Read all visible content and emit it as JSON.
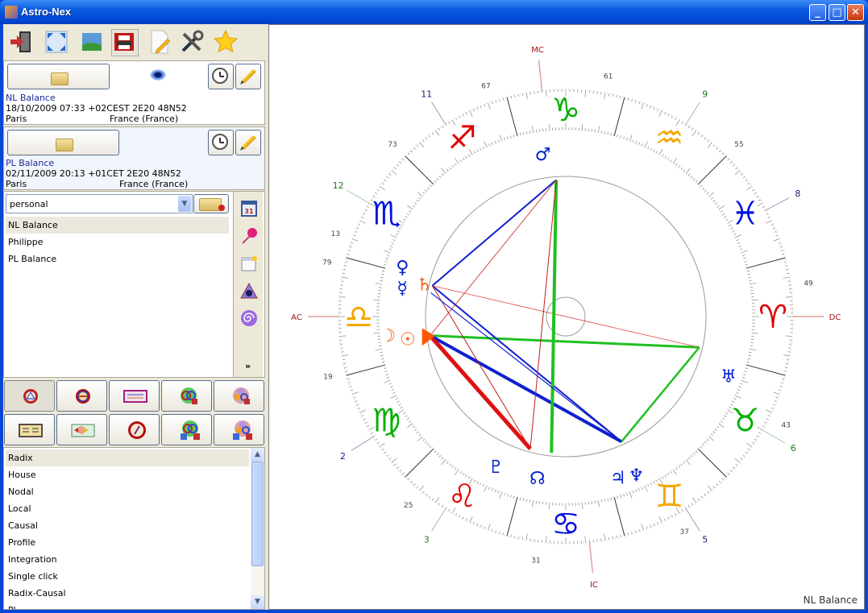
{
  "window": {
    "title": "Astro-Nex",
    "controls": {
      "minimize": "_",
      "maximize": "□",
      "close": "✕"
    }
  },
  "toolbar": {
    "items": [
      {
        "name": "exit",
        "icon": "exit-door-icon"
      },
      {
        "name": "fullscreen",
        "icon": "fullscreen-icon"
      },
      {
        "name": "image",
        "icon": "landscape-image-icon"
      },
      {
        "name": "print",
        "icon": "printer-icon"
      },
      {
        "name": "edit-document",
        "icon": "document-edit-icon"
      },
      {
        "name": "settings",
        "icon": "tools-icon"
      },
      {
        "name": "favorites",
        "icon": "star-icon"
      }
    ]
  },
  "chart1": {
    "name": "NL Balance",
    "datetime": "18/10/2009 07:33 +02CEST 2E20 48N52",
    "city": "Paris",
    "country": "France (France)",
    "visible_icon": "eye-icon"
  },
  "chart2": {
    "name": "PL Balance",
    "datetime": "02/11/2009 20:13 +01CET 2E20 48N52",
    "city": "Paris",
    "country": "France (France)"
  },
  "file_browser": {
    "category": "personal",
    "items": [
      "NL Balance",
      "Philippe",
      "PL Balance"
    ],
    "selected": "NL Balance",
    "more_label": "»"
  },
  "side_tools": [
    "calendar-icon",
    "pin-icon",
    "new-file-icon",
    "eye-triangle-icon",
    "spiral-icon"
  ],
  "chart_types": {
    "row1": [
      "radix",
      "house",
      "comparison",
      "synastry",
      "composite"
    ],
    "row2": [
      "table",
      "grid",
      "compass",
      "synastry-pair",
      "composite-pair"
    ],
    "pressed": "radix"
  },
  "chart_list": {
    "items": [
      "Radix",
      "House",
      "Nodal",
      "Local",
      "Causal",
      "Profile",
      "Integration",
      "Single click",
      "Radix-Causal",
      "Pl..."
    ],
    "selected": "Radix"
  },
  "wheel": {
    "footer_label": "NL Balance",
    "angles": {
      "ac": "AC",
      "dc": "DC",
      "mc": "MC",
      "ic": "IC"
    },
    "house_numbers": [
      "2",
      "3",
      "5",
      "6",
      "8",
      "9",
      "11",
      "12"
    ],
    "age_ticks": [
      "61",
      "55",
      "49",
      "43",
      "37",
      "31",
      "25",
      "19",
      "13",
      "79",
      "73",
      "67"
    ],
    "signs": [
      {
        "sign": "libra",
        "color": "#f5a800"
      },
      {
        "sign": "scorpio",
        "color": "#0010e0"
      },
      {
        "sign": "sagittarius",
        "color": "#e00000"
      },
      {
        "sign": "capricorn",
        "color": "#00b000"
      },
      {
        "sign": "aquarius",
        "color": "#f5a800"
      },
      {
        "sign": "pisces",
        "color": "#0010e0"
      },
      {
        "sign": "aries",
        "color": "#e00000"
      },
      {
        "sign": "taurus",
        "color": "#00b000"
      },
      {
        "sign": "gemini",
        "color": "#f5a800"
      },
      {
        "sign": "cancer",
        "color": "#0010e0"
      },
      {
        "sign": "leo",
        "color": "#e00000"
      },
      {
        "sign": "virgo",
        "color": "#00b000"
      }
    ],
    "planets": [
      {
        "name": "sun",
        "glyph": "☉",
        "color": "#f06010"
      },
      {
        "name": "moon",
        "glyph": "☽",
        "color": "#f06010"
      },
      {
        "name": "mercury",
        "glyph": "☿",
        "color": "#0020d0"
      },
      {
        "name": "venus",
        "glyph": "♀",
        "color": "#0020d0"
      },
      {
        "name": "mars",
        "glyph": "♂",
        "color": "#0020d0"
      },
      {
        "name": "jupiter",
        "glyph": "♃",
        "color": "#0020d0"
      },
      {
        "name": "saturn",
        "glyph": "♄",
        "color": "#f06010"
      },
      {
        "name": "uranus",
        "glyph": "♅",
        "color": "#0020d0"
      },
      {
        "name": "neptune",
        "glyph": "♆",
        "color": "#0020d0"
      },
      {
        "name": "pluto",
        "glyph": "♇",
        "color": "#0020d0"
      },
      {
        "name": "node",
        "glyph": "☊",
        "color": "#0020d0"
      }
    ]
  }
}
